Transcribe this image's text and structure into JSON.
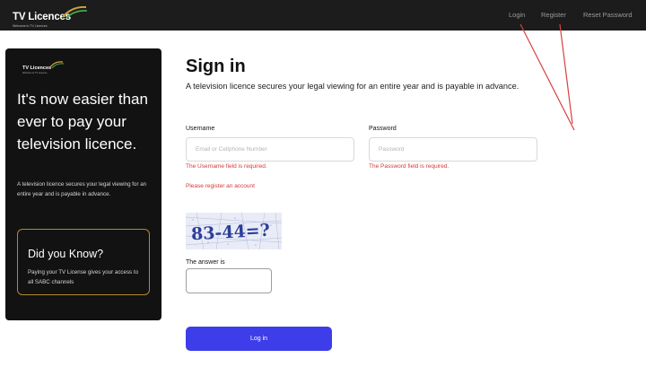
{
  "header": {
    "brand_title": "TV Licences",
    "brand_subtitle": "Welcome to TV Licences",
    "nav": {
      "login": "Login",
      "register": "Register",
      "reset_password": "Reset Password"
    }
  },
  "promo": {
    "logo_title": "TV Licences",
    "logo_subtitle": "Welcome to TV Licences",
    "headline": "It's now easier than ever to pay your television licence.",
    "text": "A television licence secures your legal viewing for an entire year and is payable in advance.",
    "card": {
      "title": "Did you Know?",
      "text": "Paying your TV License gives your access to all SABC channels"
    }
  },
  "form": {
    "title": "Sign in",
    "subtitle": "A television licence secures your legal viewing for an entire year and is payable in advance.",
    "username": {
      "label": "Username",
      "placeholder": "Email or Cellphone Number",
      "value": "",
      "error": "The Username field is required."
    },
    "password": {
      "label": "Password",
      "placeholder": "Password",
      "value": "",
      "error": "The Password field is required."
    },
    "register_error": "Please register an account",
    "captcha_text": "83-44=?",
    "answer": {
      "label": "The answer is",
      "value": ""
    },
    "login_button": "Log in"
  },
  "colors": {
    "topbar": "#1c1c1c",
    "promo_bg": "#121212",
    "card_border": "#b18a2c",
    "error": "#d23a3a",
    "button": "#3d3dea",
    "annotation": "#d94040"
  }
}
